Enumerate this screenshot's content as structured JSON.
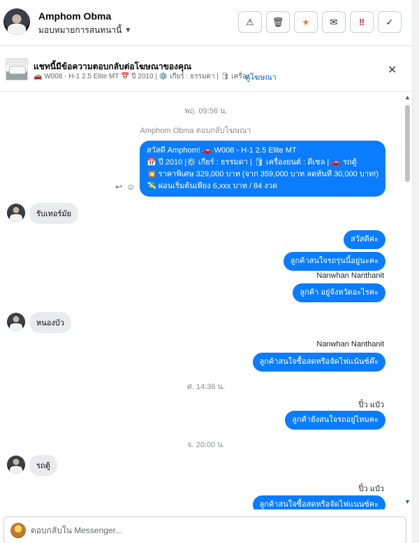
{
  "header": {
    "contact_name": "Amphom Obma",
    "assign_label": "มอบหมายการสนทนานี้",
    "actions": {
      "warning_icon": "⚠",
      "trash_icon": "🗑",
      "star_icon": "★",
      "mail_icon": "✉",
      "spam_icon": "‼",
      "done_icon": "✓"
    }
  },
  "ad": {
    "title": "แชทนี้มีข้อความตอบกลับต่อโฆษณาของคุณ",
    "subtitle": "🚗 W008 - H-1 2.5 Elite MT 📅 ปี 2010 | ⚙️ เกียร์ : ธรรมดา | 🛢 เครื่อง...",
    "link": "ดูโฆษณา",
    "close_icon": "✕"
  },
  "thread": {
    "ts1": "พฤ. 09:56 น.",
    "system_reply": "Amphom Obma ตอบกลับโฆษณา",
    "ad_message": [
      "สวัสดี Amphom! 🚗 W008 - H-1 2.5 Elite MT",
      "📅 ปี 2010 |⚙️ เกียร์ : ธรรมดา | 🛢 เครื่องยนต์ : ดีเซล | 🚗 รถตู้",
      "💥 ราคาพิเศษ 329,000 บาท (จาก 359,000 บาท ลดทันที 30,000 บาท!)",
      "💸 ผ่อนเริ่มต้นเพียง 6,xxx บาท / 84 งวด"
    ],
    "reply_icon": "↩",
    "emoji_icon": "☺",
    "in1": "รับเทอร์มัย",
    "out1": "สวัสดีค่ะ",
    "out2": "ลูกค้าสนใจรถรุ่นนี้อยู่นะคะ",
    "sender1": "Nanwhan Nanthanit",
    "out3": "ลูกค้า อยู่จังหวัดอะไรคะ",
    "in2": "หนองบัว",
    "sender2": "Nanwhan Nanthanit",
    "out4": "ลูกค้าสนใจซื้อสดหรือจัดไฟแน้นซ์ค๊ะ",
    "ts2": "ศ. 14:36 น.",
    "sender3": "ปิ๋ว แป๋ว",
    "out5": "ลูกค้ายังสนใจรถอยู่ไหมคะ",
    "ts3": "จ. 20:00 น.",
    "in3": "รถตู้",
    "sender4": "ปิ๋ว แป๋ว",
    "out6": "ลูกค้าสนใจซื้อสดหรือจัดไฟแนนซ์คะ"
  },
  "scrollbar": {
    "up": "▲",
    "down": "▼"
  },
  "composer": {
    "placeholder": "ตอบกลับใน Messenger..."
  }
}
